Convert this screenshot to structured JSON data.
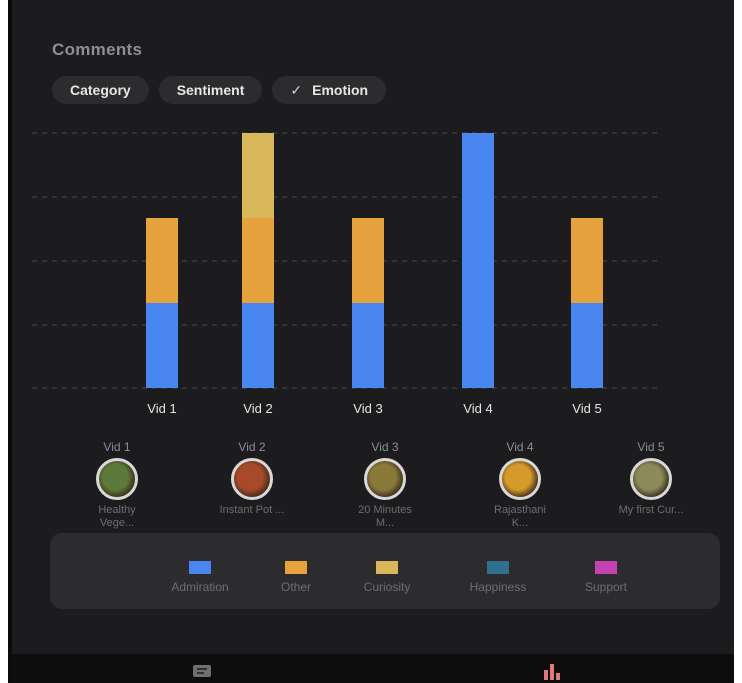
{
  "header": {
    "title": "Comments"
  },
  "filters": [
    {
      "label": "Category",
      "selected": false
    },
    {
      "label": "Sentiment",
      "selected": false
    },
    {
      "label": "Emotion",
      "selected": true
    }
  ],
  "chart_data": {
    "type": "bar",
    "stacked": true,
    "categories": [
      "Vid 1",
      "Vid 2",
      "Vid 3",
      "Vid 4",
      "Vid 5"
    ],
    "series": [
      {
        "name": "Admiration",
        "color": "#4a86f0",
        "values": [
          1,
          1,
          1,
          3,
          1
        ]
      },
      {
        "name": "Other",
        "color": "#e6a23c",
        "values": [
          1,
          1,
          1,
          0,
          1
        ]
      },
      {
        "name": "Curiosity",
        "color": "#d9b85c",
        "values": [
          0,
          1,
          0,
          0,
          0
        ]
      },
      {
        "name": "Happiness",
        "color": "#2f6f8f",
        "values": [
          0,
          0,
          0,
          0,
          0
        ]
      },
      {
        "name": "Support",
        "color": "#c542b4",
        "values": [
          0,
          0,
          0,
          0,
          0
        ]
      }
    ],
    "ylim": [
      0,
      3
    ],
    "grid": true,
    "legend": "bottom"
  },
  "videos": [
    {
      "label": "Vid 1",
      "caption_line1": "Healthy",
      "caption_line2": "Vege...",
      "thumb_color": "#5d7a3a"
    },
    {
      "label": "Vid 2",
      "caption_line1": "Instant Pot ...",
      "caption_line2": "",
      "thumb_color": "#a84a2a"
    },
    {
      "label": "Vid 3",
      "caption_line1": "20 Minutes",
      "caption_line2": "M...",
      "thumb_color": "#8a7a3a"
    },
    {
      "label": "Vid 4",
      "caption_line1": "Rajasthani",
      "caption_line2": "K...",
      "thumb_color": "#d69a2a"
    },
    {
      "label": "Vid 5",
      "caption_line1": "My first Cur...",
      "caption_line2": "",
      "thumb_color": "#8a8a5a"
    }
  ],
  "legend": [
    {
      "label": "Admiration",
      "color": "#4a86f0"
    },
    {
      "label": "Other",
      "color": "#e6a23c"
    },
    {
      "label": "Curiosity",
      "color": "#d9b85c"
    },
    {
      "label": "Happiness",
      "color": "#2f6f8f"
    },
    {
      "label": "Support",
      "color": "#c542b4"
    }
  ],
  "nav": [
    {
      "icon": "comment-icon"
    },
    {
      "icon": "bar-chart-icon"
    }
  ]
}
